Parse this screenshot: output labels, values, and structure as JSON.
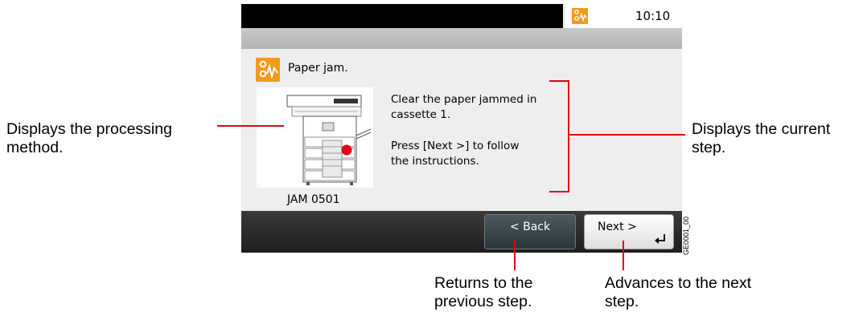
{
  "screen": {
    "clock": "10:10",
    "error_title": "Paper jam.",
    "jam_code": "JAM 0501",
    "step_lines": [
      "Clear the paper jammed in",
      "cassette 1.",
      "Press [Next >] to follow",
      "the instructions."
    ],
    "back_label": "< Back",
    "next_label": "Next >"
  },
  "annotations": {
    "left": [
      "Displays the processing",
      "method."
    ],
    "right": [
      "Displays the current",
      "step."
    ],
    "back": [
      "Returns to the",
      "previous step."
    ],
    "next": [
      "Advances to the next",
      "step."
    ]
  },
  "figure_code": "GE0001_00",
  "colors": {
    "accent": "#f29a1d",
    "annotation_line": "#e2001a",
    "back_button": "#33403f"
  }
}
